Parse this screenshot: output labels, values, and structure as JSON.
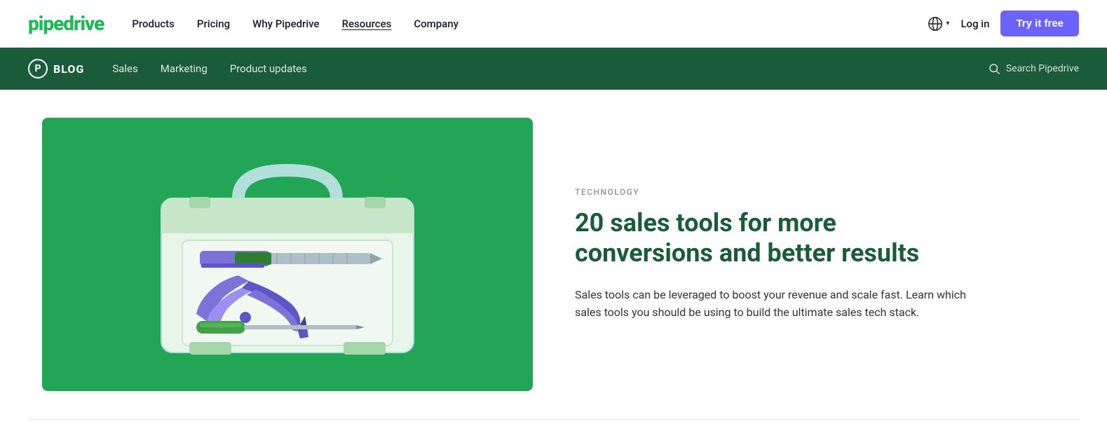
{
  "logo": {
    "text": "pipedrive"
  },
  "top_nav": {
    "links": [
      {
        "label": "Products",
        "active": false
      },
      {
        "label": "Pricing",
        "active": false
      },
      {
        "label": "Why Pipedrive",
        "active": false
      },
      {
        "label": "Resources",
        "active": true
      },
      {
        "label": "Company",
        "active": false
      }
    ],
    "login_label": "Log in",
    "try_free_label": "Try it free"
  },
  "blog_bar": {
    "p_icon": "P",
    "blog_label": "BLOG",
    "nav_links": [
      {
        "label": "Sales"
      },
      {
        "label": "Marketing"
      },
      {
        "label": "Product updates"
      }
    ],
    "search_placeholder": "Search Pipedrive"
  },
  "article": {
    "category": "TECHNOLOGY",
    "title": "20 sales tools for more conversions and better results",
    "description": "Sales tools can be leveraged to boost your revenue and scale fast. Learn which sales tools you should be using to build the ultimate sales tech stack."
  },
  "colors": {
    "green_dark": "#1a5c3a",
    "green_medium": "#22a655",
    "green_light": "#4cc97a",
    "purple": "#6c63ff",
    "toolbox_bg": "#22a655"
  }
}
